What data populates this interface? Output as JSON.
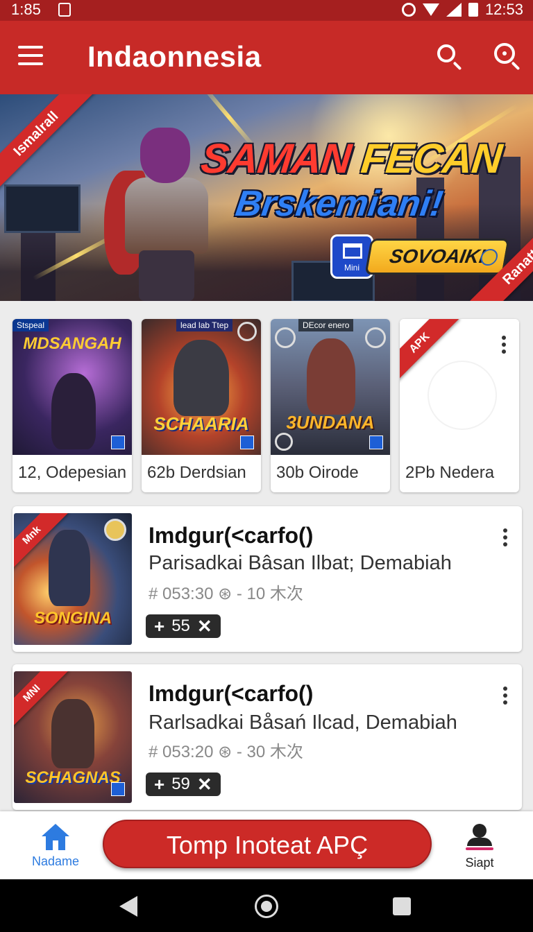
{
  "status_bar": {
    "time_left": "1:85",
    "time_right": "12:53"
  },
  "app_bar": {
    "title": "Indaonnesia",
    "icons": [
      "menu-icon",
      "search-icon",
      "search-icon"
    ]
  },
  "hero": {
    "headline_red": "SAMAN",
    "headline_gold": "FECAN",
    "subheadline": "Brskemiani!",
    "badge_text": "Mini",
    "promo_label": "SOVOAIKI",
    "ribbon_left": "Ismalrall",
    "ribbon_right": "Ranatt"
  },
  "grid": {
    "cards": [
      {
        "label": "12, Odepesian",
        "tag": "Stspeal",
        "art_title": "MDSANGAH"
      },
      {
        "label": "62b Derdsian",
        "tag": "lead lab Ttep",
        "art_title": "SCHAARIA"
      },
      {
        "label": "30b Oirode",
        "tag": "DEcor enero",
        "art_title": "3UNDANA"
      },
      {
        "label": "2Pb Nedera",
        "ribbon": "APK"
      }
    ]
  },
  "list": {
    "items": [
      {
        "name": "Imdgur(<carfo()",
        "description": "Parisadkai Bâsan Ilbat; Demabiah",
        "meta": "# 053:30 ⊛ - 10 木次",
        "count": "55",
        "ribbon": "Mnk",
        "art_title": "SONGINA"
      },
      {
        "name": "Imdgur(<carfo()",
        "description": "Rarlsadkai Båsań Ilcad, Demabiah",
        "meta": "# 053:20 ⊛ - 30 木次",
        "count": "59",
        "ribbon": "MNI",
        "art_title": "SCHAGNAS"
      }
    ]
  },
  "bottom_nav": {
    "home_label": "Nadame",
    "cta_label": "Tomp Inoteat APÇ",
    "profile_label": "Siapt"
  },
  "colors": {
    "primary": "#c72a27",
    "status_bar": "#a51f1f",
    "accent_blue": "#2d7be0"
  }
}
